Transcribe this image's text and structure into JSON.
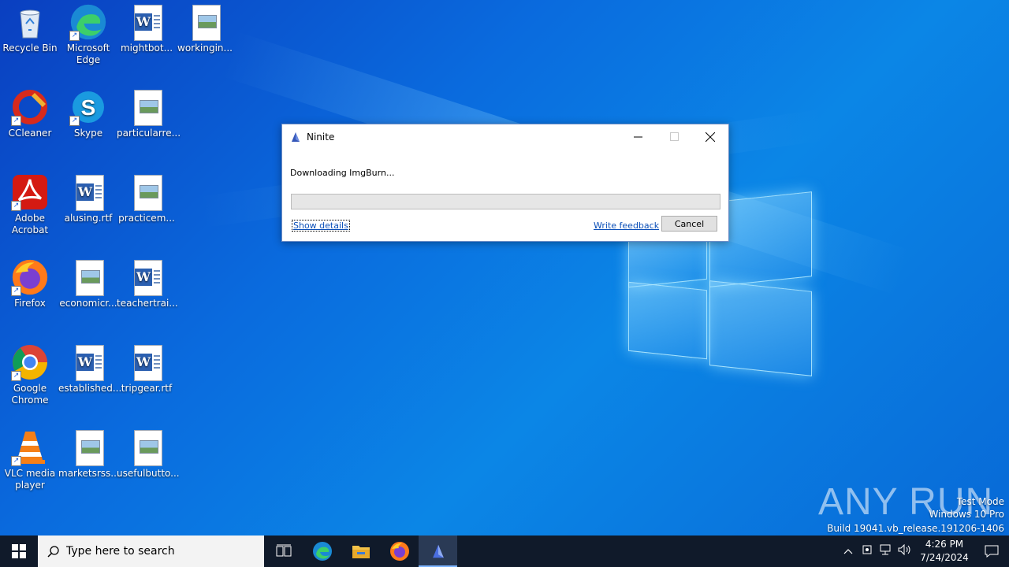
{
  "desktop": {
    "icons": [
      {
        "label": "Recycle Bin",
        "icon": "recycle-bin-icon"
      },
      {
        "label": "Microsoft Edge",
        "icon": "edge-icon"
      },
      {
        "label": "mightbot...",
        "icon": "word-document-icon"
      },
      {
        "label": "workingin...",
        "icon": "image-document-icon"
      },
      {
        "label": "CCleaner",
        "icon": "ccleaner-icon"
      },
      {
        "label": "Skype",
        "icon": "skype-icon"
      },
      {
        "label": "particularre...",
        "icon": "image-document-icon"
      },
      {
        "label": "Adobe Acrobat",
        "icon": "acrobat-icon"
      },
      {
        "label": "alusing.rtf",
        "icon": "word-document-icon"
      },
      {
        "label": "practicem...",
        "icon": "image-document-icon"
      },
      {
        "label": "Firefox",
        "icon": "firefox-icon"
      },
      {
        "label": "economicr...",
        "icon": "image-document-icon"
      },
      {
        "label": "teachertrai...",
        "icon": "word-document-icon"
      },
      {
        "label": "Google Chrome",
        "icon": "chrome-icon"
      },
      {
        "label": "established...",
        "icon": "word-document-icon"
      },
      {
        "label": "tripgear.rtf",
        "icon": "word-document-icon"
      },
      {
        "label": "VLC media player",
        "icon": "vlc-icon"
      },
      {
        "label": "marketsrss....",
        "icon": "image-document-icon"
      },
      {
        "label": "usefulbutto...",
        "icon": "image-document-icon"
      }
    ]
  },
  "dialog": {
    "title": "Ninite",
    "status": "Downloading ImgBurn...",
    "progress": 0,
    "show_details": "Show details",
    "write_feedback": "Write feedback",
    "cancel": "Cancel"
  },
  "watermark": {
    "brand": "ANY RUN",
    "line1": "Test Mode",
    "line2": "Windows 10 Pro",
    "line3": "Build 19041.vb_release.191206-1406"
  },
  "taskbar": {
    "search_placeholder": "Type here to search",
    "apps": [
      "task-view-icon",
      "edge-icon",
      "file-explorer-icon",
      "firefox-icon",
      "ninite-icon"
    ],
    "time": "4:26 PM",
    "date": "7/24/2024"
  },
  "colors": {
    "taskbar": "#101a2a",
    "link": "#0b4fb8",
    "desktop": "#0a6bde"
  }
}
